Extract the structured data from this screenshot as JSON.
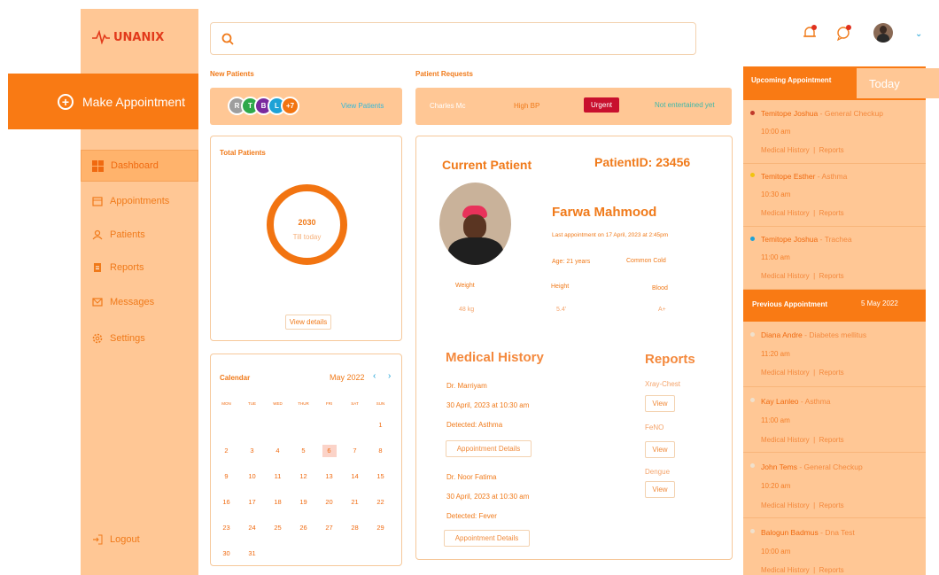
{
  "brand": {
    "name": "UNANIX"
  },
  "make_appointment": {
    "label": "Make Appointment"
  },
  "nav": [
    {
      "label": "Dashboard"
    },
    {
      "label": "Appointments"
    },
    {
      "label": "Patients"
    },
    {
      "label": "Reports"
    },
    {
      "label": "Messages"
    },
    {
      "label": "Settings"
    }
  ],
  "logout": {
    "label": "Logout"
  },
  "new_patients": {
    "title": "New Patients",
    "avatars": [
      "R",
      "T",
      "B",
      "L",
      "+7"
    ],
    "avatar_colors": [
      "#9e9e9e",
      "#2ea84a",
      "#7a2a9e",
      "#1ea2d6",
      "#f27411"
    ],
    "link": "View Patients"
  },
  "patient_requests": {
    "title": "Patient Requests",
    "name": "Charles Mc",
    "issue": "High BP",
    "badge": "Urgent",
    "status": "Not entertained yet"
  },
  "total_patients": {
    "title": "Total Patients",
    "value": "2030",
    "caption": "Till today",
    "button": "View details"
  },
  "calendar": {
    "title": "Calendar",
    "month": "May 2022",
    "days": [
      "MON",
      "TUE",
      "WED",
      "THUR",
      "FRI",
      "SAT",
      "SUN"
    ],
    "weeks": [
      [
        "",
        "",
        "",
        "",
        "",
        "",
        "1"
      ],
      [
        "2",
        "3",
        "4",
        "5",
        "6",
        "7",
        "8"
      ],
      [
        "9",
        "10",
        "11",
        "12",
        "13",
        "14",
        "15"
      ],
      [
        "16",
        "17",
        "18",
        "19",
        "20",
        "21",
        "22"
      ],
      [
        "23",
        "24",
        "25",
        "26",
        "27",
        "28",
        "29"
      ],
      [
        "30",
        "31",
        "",
        "",
        "",
        "",
        ""
      ]
    ],
    "selected": "6"
  },
  "current_patient": {
    "title": "Current Patient",
    "id_label": "PatientID: 23456",
    "name": "Farwa Mahmood",
    "last_appt": "Last appointment on 17 April, 2023 at 2:45pm",
    "age": "Age: 21 years",
    "condition": "Common Cold",
    "weight_label": "Weight",
    "weight": "48 kg",
    "height_label": "Height",
    "height": "5.4'",
    "blood_label": "Blood",
    "blood": "A+"
  },
  "medical_history": {
    "title": "Medical History",
    "entries": [
      {
        "doctor": "Dr. Marriyam",
        "date": "30 April, 2023 at 10:30 am",
        "detected": "Detected: Asthma",
        "button": "Appointment Details"
      },
      {
        "doctor": "Dr. Noor Fatima",
        "date": "30 April, 2023 at 10:30 am",
        "detected": "Detected: Fever",
        "button": "Appointment Details"
      }
    ]
  },
  "reports": {
    "title": "Reports",
    "items": [
      {
        "name": "Xray-Chest",
        "button": "View"
      },
      {
        "name": "FeNO",
        "button": "View"
      },
      {
        "name": "Dengue",
        "button": "View"
      }
    ]
  },
  "upcoming": {
    "title": "Upcoming Appointment",
    "today": "Today",
    "items": [
      {
        "name": "Temitope Joshua",
        "type": "General Checkup",
        "time": "10:00 am",
        "dot": "#c0392b"
      },
      {
        "name": "Temitope Esther",
        "type": "Asthma",
        "time": "10:30 am",
        "dot": "#f1c40f"
      },
      {
        "name": "Temitope Joshua",
        "type": "Trachea",
        "time": "11:00 am",
        "dot": "#1ea2d6"
      }
    ]
  },
  "previous": {
    "title": "Previous Appointment",
    "date": "5 May 2022",
    "items": [
      {
        "name": "Diana Andre",
        "type": "Diabetes mellitus",
        "time": "11:20 am"
      },
      {
        "name": "Kay Lanleo",
        "type": "Asthma",
        "time": "11:00 am"
      },
      {
        "name": "John Tems",
        "type": "General Checkup",
        "time": "10:20 am"
      },
      {
        "name": "Balogun Badmus",
        "type": "Dna Test",
        "time": "10:00 am"
      }
    ]
  },
  "appt_links": {
    "history": "Medical History",
    "reports": "Reports"
  }
}
